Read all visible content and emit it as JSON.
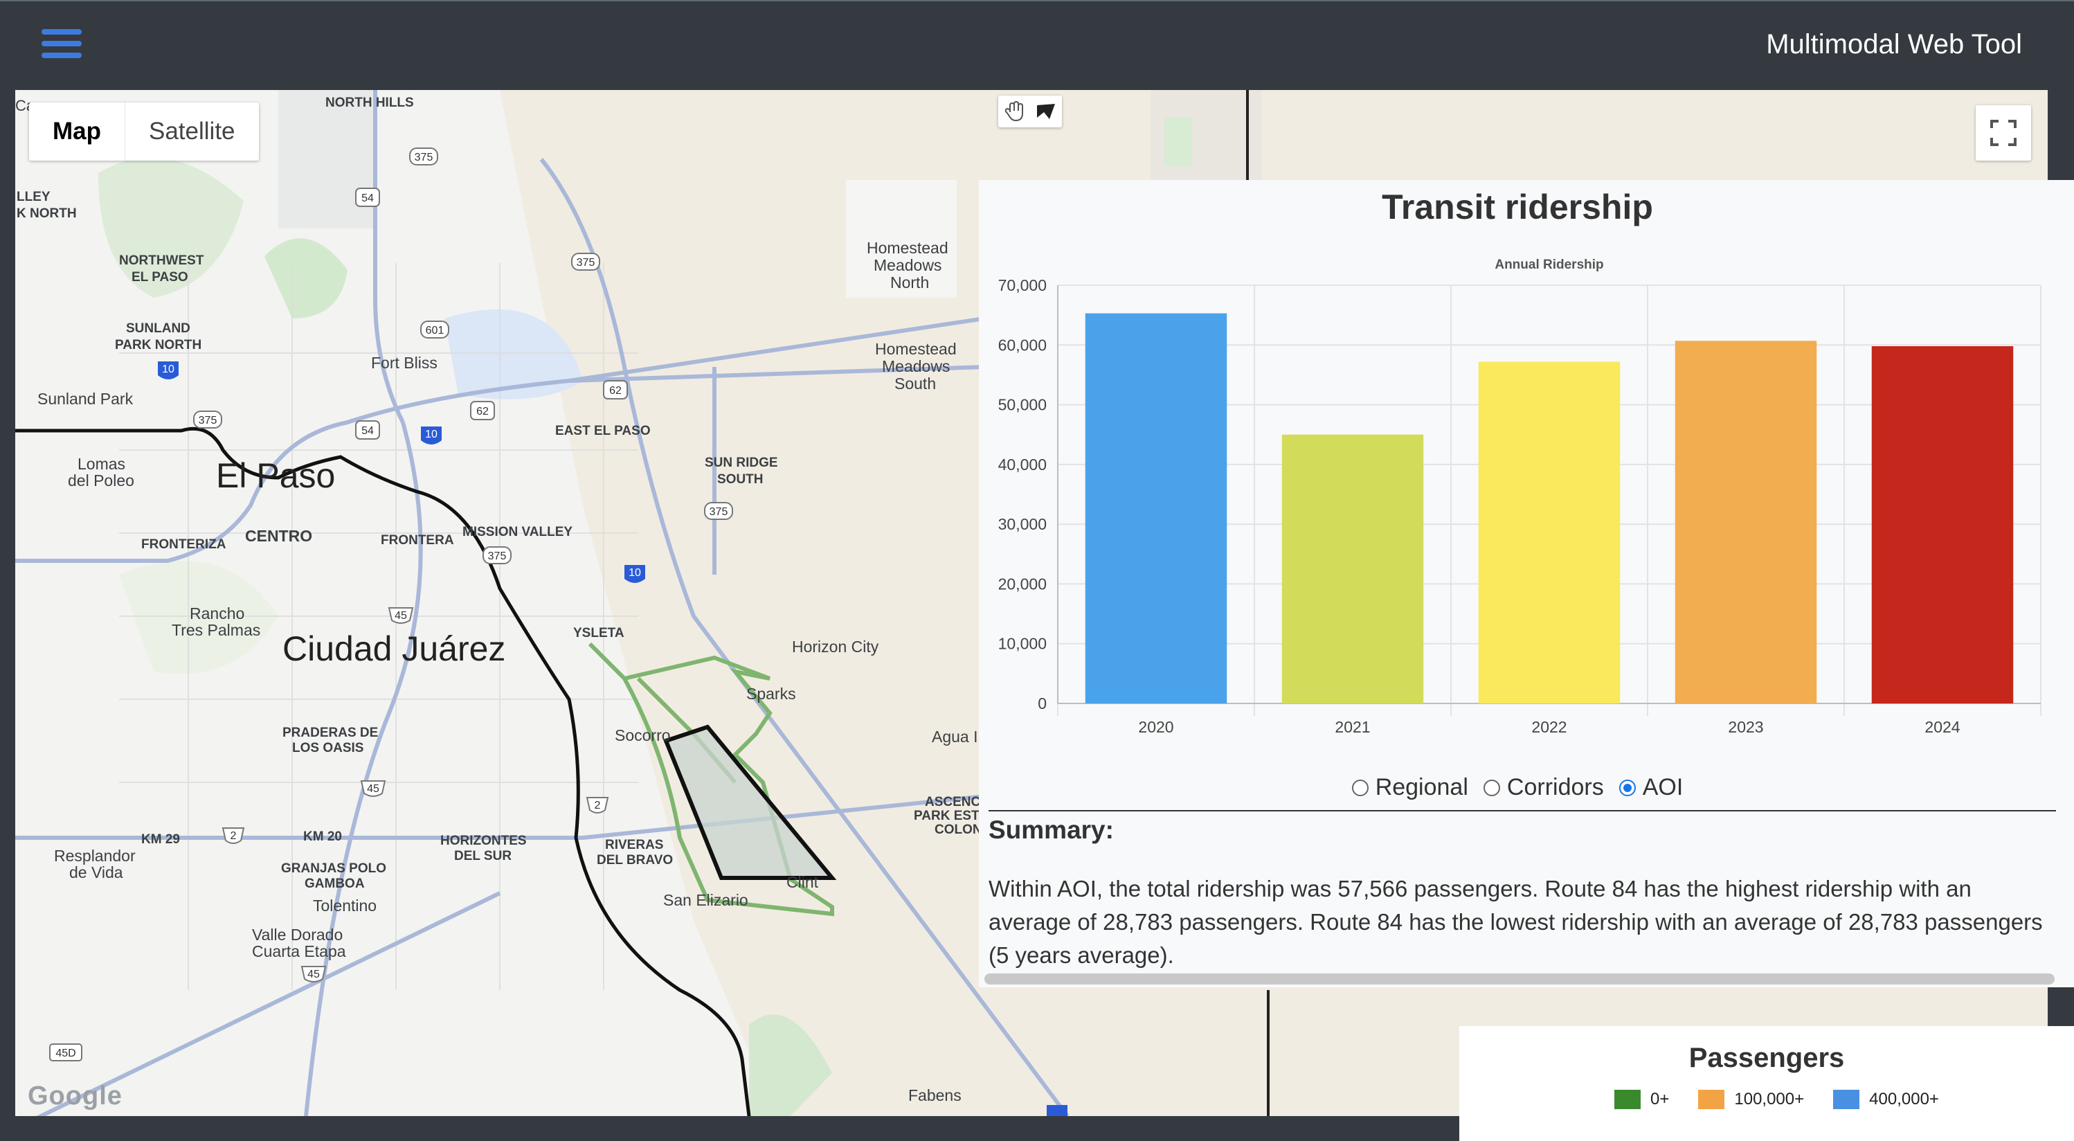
{
  "header": {
    "title": "Multimodal Web Tool",
    "menu_icon": "hamburger-icon"
  },
  "map": {
    "type_control": {
      "map_label": "Map",
      "satellite_label": "Satellite",
      "selected": "Map"
    },
    "draw_tools": [
      "hand-icon",
      "polygon-icon"
    ],
    "fullscreen_icon": "fullscreen-icon",
    "attribution": "Google",
    "labels": {
      "el_paso": "El Paso",
      "ciudad_juarez": "Ciudad Juárez",
      "north_hills": "NORTH HILLS",
      "valley_north": "LLEY\nK NORTH",
      "northwest": "NORTHWEST\nEL PASO",
      "sunland_park_north": "SUNLAND\nPARK NORTH",
      "sunland_park": "Sunland Park",
      "lomas": "Lomas\ndel Poleo",
      "fort_bliss": "Fort Bliss",
      "east_el_paso": "EAST EL PASO",
      "sun_ridge": "SUN RIDGE\nSOUTH",
      "homestead_north": "Homestead\nMeadows\nNorth",
      "homestead_south": "Homestead\nMeadows\nSouth",
      "mission_valley": "MISSION VALLEY",
      "centro": "CENTRO",
      "fronteriza": "FRONTERIZA",
      "frontera": "FRONTERA",
      "rancho": "Rancho\nTres Palmas",
      "ysleta": "YSLETA",
      "horizon_city": "Horizon City",
      "sparks": "Sparks",
      "socorro": "Socorro",
      "agua": "Agua I",
      "praderas": "PRADERAS DE\nLOS OASIS",
      "km29": "KM 29",
      "km20": "KM 20",
      "horizontes": "HORIZONTES\nDEL SUR",
      "riveras": "RIVERAS\nDEL BRAVO",
      "resplandor": "Resplandor\nde Vida",
      "granjas": "GRANJAS POLO\nGAMBOA",
      "tolentino": "Tolentino",
      "valle_dorado": "Valle Dorado\nCuarta Etapa",
      "san_elizario": "San Elizario",
      "clint": "Clint",
      "ascencion": "ASCENC\nPARK EST\nCOLON",
      "fabens": "Fabens",
      "cal": "Ca"
    },
    "shields": {
      "i10": "10",
      "us54": "54",
      "us62": "62",
      "loop375": "375",
      "fm601": "601",
      "mx45": "45",
      "mx2": "2",
      "r45d": "45D"
    }
  },
  "panel": {
    "title": "Transit ridership",
    "radio_options": [
      {
        "label": "Regional",
        "checked": false
      },
      {
        "label": "Corridors",
        "checked": false
      },
      {
        "label": "AOI",
        "checked": true
      }
    ],
    "summary_title": "Summary:",
    "summary_text": "Within AOI, the total ridership was 57,566 passengers. Route 84 has the highest ridership with an average of 28,783 passengers. Route 84 has the lowest ridership with an average of 28,783 passengers (5 years average)."
  },
  "chart_data": {
    "type": "bar",
    "title": "Annual Ridership",
    "categories": [
      "2020",
      "2021",
      "2022",
      "2023",
      "2024"
    ],
    "values": [
      65300,
      45000,
      57200,
      60700,
      59800
    ],
    "colors": [
      "#4aa3ea",
      "#d3dc5a",
      "#fbe95d",
      "#f2ad50",
      "#c5271d"
    ],
    "ylim": [
      0,
      70000
    ],
    "yticks": [
      0,
      10000,
      20000,
      30000,
      40000,
      50000,
      60000,
      70000
    ],
    "ytick_labels": [
      "0",
      "10,000",
      "20,000",
      "30,000",
      "40,000",
      "50,000",
      "60,000",
      "70,000"
    ],
    "xlabel": "",
    "ylabel": "",
    "grid": true,
    "legend": "none"
  },
  "legend": {
    "title": "Passengers",
    "items": [
      {
        "label": "0+",
        "color": "#3a8a2d"
      },
      {
        "label": "100,000+",
        "color": "#f2a444"
      },
      {
        "label": "400,000+",
        "color": "#4a90e2"
      }
    ]
  }
}
